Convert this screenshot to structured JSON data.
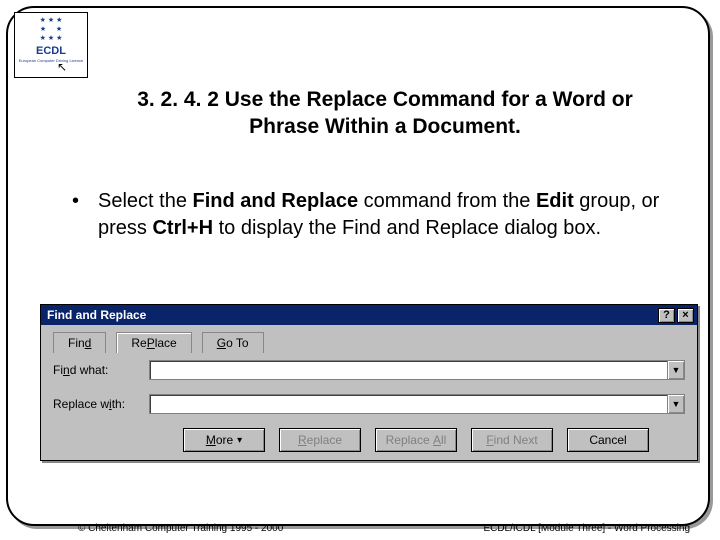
{
  "logo": {
    "abbr": "ECDL",
    "subline": "European Computer\nDriving Licence"
  },
  "title": "3. 2. 4. 2 Use the Replace Command for a Word or Phrase Within a Document.",
  "bullet": {
    "pre": "Select the ",
    "b1": "Find and Replace",
    "mid1": " command from the ",
    "b2": "Edit",
    "mid2": " group, or press ",
    "b3": "Ctrl+H",
    "post": " to display the Find and Replace dialog box."
  },
  "dialog": {
    "title": "Find and Replace",
    "help": "?",
    "close": "×",
    "tabs": {
      "find": "Find",
      "find_u": "d",
      "replace": "Replace",
      "replace_u": "P",
      "goto": "Go To",
      "goto_u": "G"
    },
    "find_label_pre": "Fi",
    "find_label_u": "n",
    "find_label_post": "d what:",
    "replace_label_pre": "Replace w",
    "replace_label_u": "i",
    "replace_label_post": "th:",
    "find_value": "",
    "replace_value": "",
    "btn_more": "More",
    "btn_more_u": "M",
    "btn_replace": "Replace",
    "btn_replace_u": "R",
    "btn_replaceall": "Replace All",
    "btn_replaceall_u": "A",
    "btn_findnext": "Find Next",
    "btn_findnext_u": "F",
    "btn_cancel": "Cancel"
  },
  "footer": {
    "left": "© Cheltenham Computer Training 1995 - 2000",
    "right": "ECDL/ICDL [Module Three]  - Word Processing"
  }
}
